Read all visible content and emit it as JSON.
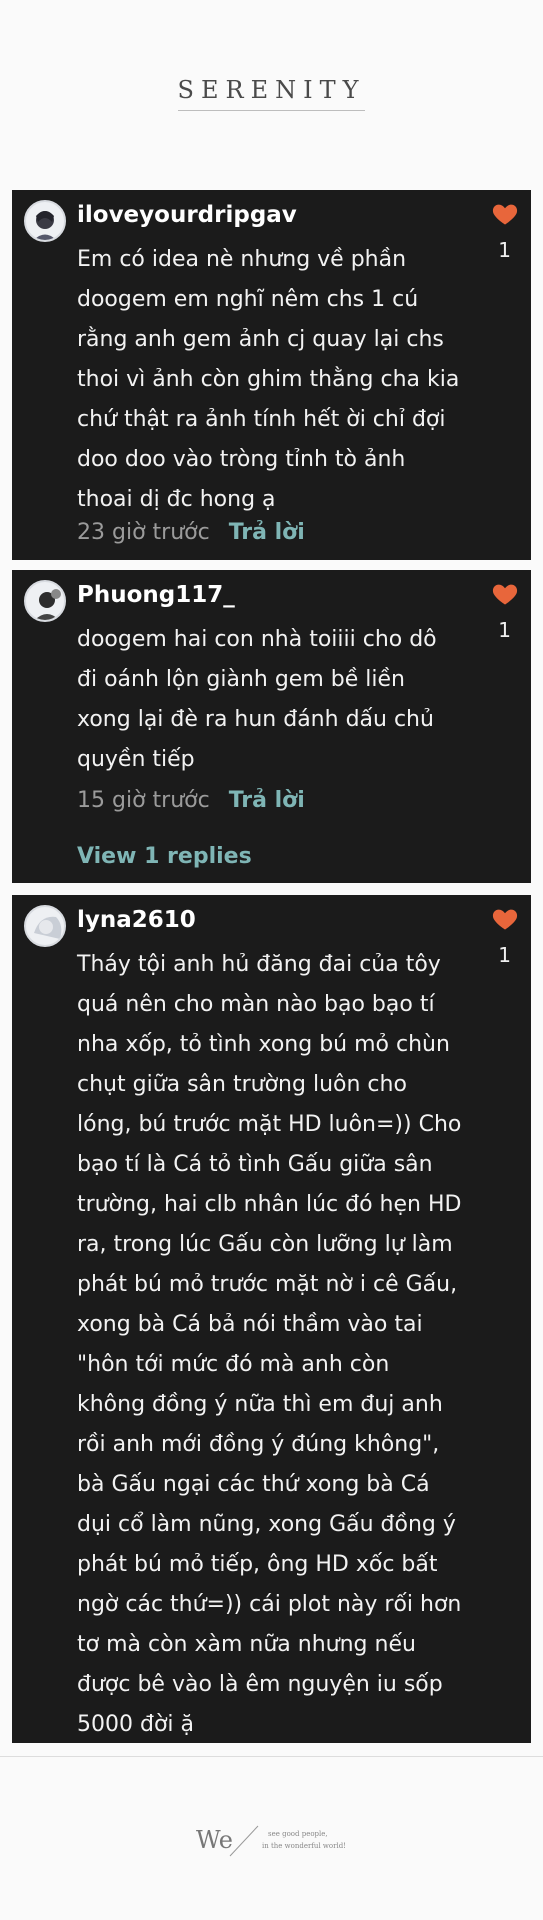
{
  "brand": {
    "title": "SERENITY"
  },
  "comments": [
    {
      "username": "iloveyourdripgav",
      "text": "Em có idea nè nhưng về phần doogem em nghĩ nêm chs 1 cú rằng anh gem ảnh cj quay lại chs thoi vì ảnh còn ghim thằng cha kia chứ thật ra ảnh tính hết ời chỉ đợi doo doo vào tròng tỉnh tò ảnh thoai dị đc hong ạ",
      "time": "23 giờ trước",
      "reply_label": "Trả lời",
      "likes": "1"
    },
    {
      "username": "Phuong117_",
      "text": "doogem hai con nhà toiiii cho dô đi oánh lộn giành gem bề liền xong lại đè ra hun đánh dấu chủ quyền tiếp",
      "time": "15 giờ trước",
      "reply_label": "Trả lời",
      "replies_label": "View 1 replies",
      "likes": "1"
    },
    {
      "username": "lyna2610",
      "text": "Tháy tội anh hủ đăng đai của tôy quá nên cho màn nào bạo bạo tí nha xốp, tỏ tình xong bú mỏ chùn chụt giữa sân trường luôn cho lóng, bú trước mặt HD luôn=)) Cho bạo tí là Cá tỏ tình Gấu giữa sân trường, hai clb nhân lúc đó hẹn HD ra, trong lúc Gấu còn lưỡng lự làm phát bú mỏ trước mặt nờ i cê Gấu, xong bà Cá bả nói thầm vào tai \"hôn tới mức đó mà anh còn không đồng ý nữa thì em đuj anh rồi anh mới đồng ý đúng không\", bà Gấu ngại các thứ xong bà Cá dụi cổ làm nũng, xong Gấu đồng ý phát bú mỏ tiếp, ông HD xốc bất ngờ các thứ=)) cái plot này rối hơn tơ mà còn xàm nữa nhưng nếu được bê vào là êm nguyện iu sốp 5000 đời ặ",
      "likes": "1"
    }
  ],
  "icons": {
    "heart": "heart-icon",
    "avatar": "avatar-image"
  },
  "colors": {
    "card_bg": "#1b1b1b",
    "heart": "#e8663b",
    "reply": "#7fb5b5",
    "meta": "#9b9b9b"
  },
  "footer": {
    "logo_text": "We",
    "tagline_1": "see good people,",
    "tagline_2": "in the wonderful world!"
  }
}
